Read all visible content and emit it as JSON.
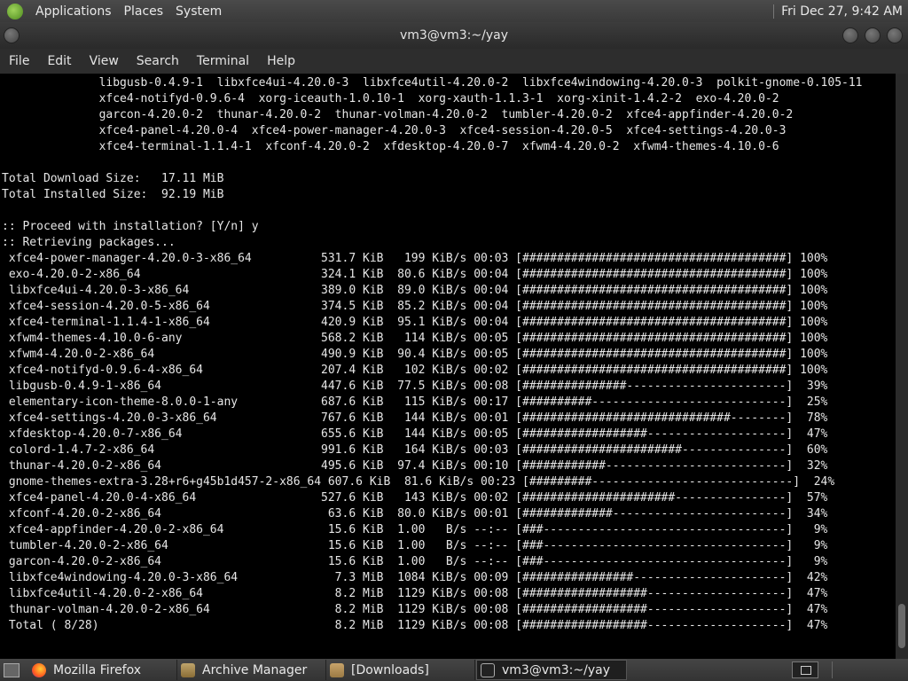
{
  "top_panel": {
    "menus": [
      "Applications",
      "Places",
      "System"
    ],
    "clock": "Fri Dec 27, 9:42 AM"
  },
  "window": {
    "title": "vm3@vm3:~/yay"
  },
  "menubar": [
    "File",
    "Edit",
    "View",
    "Search",
    "Terminal",
    "Help"
  ],
  "terminal_lines": [
    "              libgusb-0.4.9-1  libxfce4ui-4.20.0-3  libxfce4util-4.20.0-2  libxfce4windowing-4.20.0-3  polkit-gnome-0.105-11",
    "              xfce4-notifyd-0.9.6-4  xorg-iceauth-1.0.10-1  xorg-xauth-1.1.3-1  xorg-xinit-1.4.2-2  exo-4.20.0-2",
    "              garcon-4.20.0-2  thunar-4.20.0-2  thunar-volman-4.20.0-2  tumbler-4.20.0-2  xfce4-appfinder-4.20.0-2",
    "              xfce4-panel-4.20.0-4  xfce4-power-manager-4.20.0-3  xfce4-session-4.20.0-5  xfce4-settings-4.20.0-3",
    "              xfce4-terminal-1.1.4-1  xfconf-4.20.0-2  xfdesktop-4.20.0-7  xfwm4-4.20.0-2  xfwm4-themes-4.10.0-6",
    "",
    "Total Download Size:   17.11 MiB",
    "Total Installed Size:  92.19 MiB",
    "",
    ":: Proceed with installation? [Y/n] y",
    ":: Retrieving packages...",
    " xfce4-power-manager-4.20.0-3-x86_64          531.7 KiB   199 KiB/s 00:03 [######################################] 100%",
    " exo-4.20.0-2-x86_64                          324.1 KiB  80.6 KiB/s 00:04 [######################################] 100%",
    " libxfce4ui-4.20.0-3-x86_64                   389.0 KiB  89.0 KiB/s 00:04 [######################################] 100%",
    " xfce4-session-4.20.0-5-x86_64                374.5 KiB  85.2 KiB/s 00:04 [######################################] 100%",
    " xfce4-terminal-1.1.4-1-x86_64                420.9 KiB  95.1 KiB/s 00:04 [######################################] 100%",
    " xfwm4-themes-4.10.0-6-any                    568.2 KiB   114 KiB/s 00:05 [######################################] 100%",
    " xfwm4-4.20.0-2-x86_64                        490.9 KiB  90.4 KiB/s 00:05 [######################################] 100%",
    " xfce4-notifyd-0.9.6-4-x86_64                 207.4 KiB   102 KiB/s 00:02 [######################################] 100%",
    " libgusb-0.4.9-1-x86_64                       447.6 KiB  77.5 KiB/s 00:08 [###############-----------------------]  39%",
    " elementary-icon-theme-8.0.0-1-any            687.6 KiB   115 KiB/s 00:17 [##########----------------------------]  25%",
    " xfce4-settings-4.20.0-3-x86_64               767.6 KiB   144 KiB/s 00:01 [##############################--------]  78%",
    " xfdesktop-4.20.0-7-x86_64                    655.6 KiB   144 KiB/s 00:05 [##################--------------------]  47%",
    " colord-1.4.7-2-x86_64                        991.6 KiB   164 KiB/s 00:03 [#######################---------------]  60%",
    " thunar-4.20.0-2-x86_64                       495.6 KiB  97.4 KiB/s 00:10 [############--------------------------]  32%",
    " gnome-themes-extra-3.28+r6+g45b1d457-2-x86_64 607.6 KiB  81.6 KiB/s 00:23 [#########-----------------------------]  24%",
    " xfce4-panel-4.20.0-4-x86_64                  527.6 KiB   143 KiB/s 00:02 [######################----------------]  57%",
    " xfconf-4.20.0-2-x86_64                        63.6 KiB  80.0 KiB/s 00:01 [#############-------------------------]  34%",
    " xfce4-appfinder-4.20.0-2-x86_64               15.6 KiB  1.00   B/s --:-- [###-----------------------------------]   9%",
    " tumbler-4.20.0-2-x86_64                       15.6 KiB  1.00   B/s --:-- [###-----------------------------------]   9%",
    " garcon-4.20.0-2-x86_64                        15.6 KiB  1.00   B/s --:-- [###-----------------------------------]   9%",
    " libxfce4windowing-4.20.0-3-x86_64              7.3 MiB  1084 KiB/s 00:09 [################----------------------]  42%",
    " libxfce4util-4.20.0-2-x86_64                   8.2 MiB  1129 KiB/s 00:08 [##################--------------------]  47%",
    " thunar-volman-4.20.0-2-x86_64                  8.2 MiB  1129 KiB/s 00:08 [##################--------------------]  47%",
    " Total ( 8/28)                                  8.2 MiB  1129 KiB/s 00:08 [##################--------------------]  47%"
  ],
  "taskbar": [
    {
      "label": "Mozilla Firefox",
      "icon": "firefox-icon"
    },
    {
      "label": "Archive Manager",
      "icon": "archive-icon"
    },
    {
      "label": "[Downloads]",
      "icon": "folder-icon"
    },
    {
      "label": "vm3@vm3:~/yay",
      "icon": "terminal-icon"
    }
  ]
}
